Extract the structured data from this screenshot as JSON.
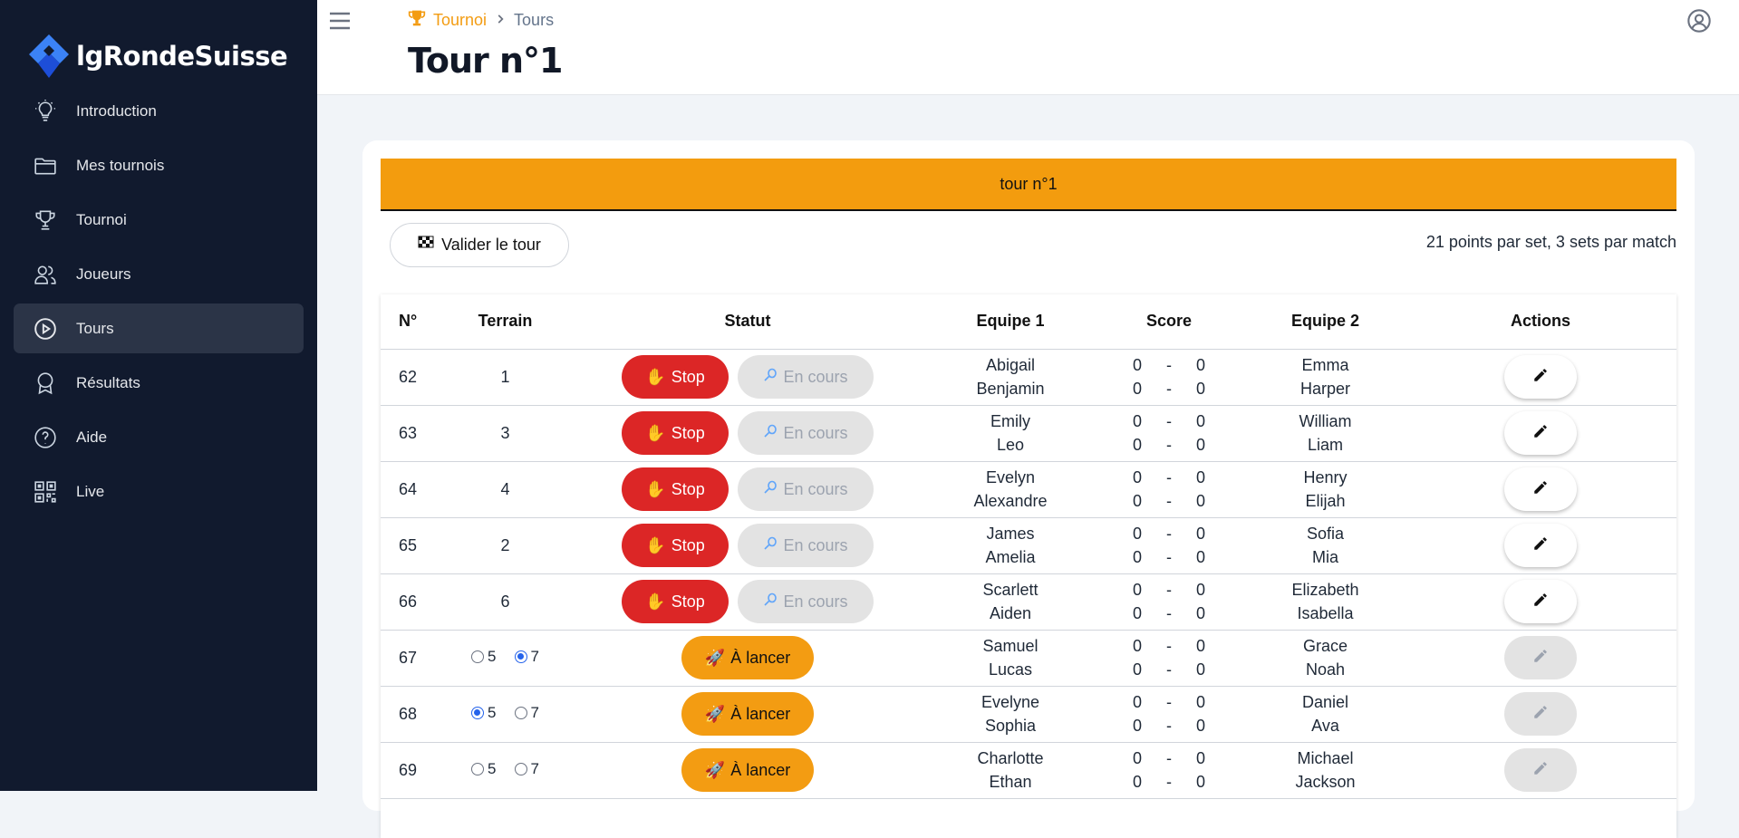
{
  "brand": {
    "name": "lgRondeSuisse"
  },
  "sidebar": {
    "items": [
      {
        "label": "Introduction",
        "icon": "lightbulb-icon"
      },
      {
        "label": "Mes tournois",
        "icon": "folder-icon"
      },
      {
        "label": "Tournoi",
        "icon": "trophy-icon"
      },
      {
        "label": "Joueurs",
        "icon": "users-icon"
      },
      {
        "label": "Tours",
        "icon": "play-circle-icon",
        "active": true
      },
      {
        "label": "Résultats",
        "icon": "ribbon-icon"
      },
      {
        "label": "Aide",
        "icon": "help-circle-icon"
      },
      {
        "label": "Live",
        "icon": "qr-code-icon"
      }
    ]
  },
  "header": {
    "breadcrumb": [
      "Tournoi",
      "Tours"
    ],
    "title": "Tour n°1"
  },
  "banner": {
    "label": "tour n°1"
  },
  "toolbar": {
    "validate_label": "Valider le tour",
    "info": "21 points par set, 3 sets par match"
  },
  "table": {
    "columns": [
      "N°",
      "Terrain",
      "Statut",
      "Equipe 1",
      "Score",
      "Equipe 2",
      "Actions"
    ],
    "stop_label": "Stop",
    "encours_label": "En cours",
    "lancer_label": "À lancer",
    "score_sep": "-",
    "rows": [
      {
        "num": "62",
        "terrain": "1",
        "team1": [
          "Abigail",
          "Benjamin"
        ],
        "team2": [
          "Emma",
          "Harper"
        ],
        "scores": [
          [
            "0",
            "0"
          ],
          [
            "0",
            "0"
          ]
        ]
      },
      {
        "num": "63",
        "terrain": "3",
        "team1": [
          "Emily",
          "Leo"
        ],
        "team2": [
          "William",
          "Liam"
        ],
        "scores": [
          [
            "0",
            "0"
          ],
          [
            "0",
            "0"
          ]
        ]
      },
      {
        "num": "64",
        "terrain": "4",
        "team1": [
          "Evelyn",
          "Alexandre"
        ],
        "team2": [
          "Henry",
          "Elijah"
        ],
        "scores": [
          [
            "0",
            "0"
          ],
          [
            "0",
            "0"
          ]
        ]
      },
      {
        "num": "65",
        "terrain": "2",
        "team1": [
          "James",
          "Amelia"
        ],
        "team2": [
          "Sofia",
          "Mia"
        ],
        "scores": [
          [
            "0",
            "0"
          ],
          [
            "0",
            "0"
          ]
        ]
      },
      {
        "num": "66",
        "terrain": "6",
        "team1": [
          "Scarlett",
          "Aiden"
        ],
        "team2": [
          "Elizabeth",
          "Isabella"
        ],
        "scores": [
          [
            "0",
            "0"
          ],
          [
            "0",
            "0"
          ]
        ]
      },
      {
        "num": "67",
        "terrain_options": [
          "5",
          "7"
        ],
        "selected": "7",
        "team1": [
          "Samuel",
          "Lucas"
        ],
        "team2": [
          "Grace",
          "Noah"
        ],
        "scores": [
          [
            "0",
            "0"
          ],
          [
            "0",
            "0"
          ]
        ]
      },
      {
        "num": "68",
        "terrain_options": [
          "5",
          "7"
        ],
        "selected": "5",
        "team1": [
          "Evelyne",
          "Sophia"
        ],
        "team2": [
          "Daniel",
          "Ava"
        ],
        "scores": [
          [
            "0",
            "0"
          ],
          [
            "0",
            "0"
          ]
        ]
      },
      {
        "num": "69",
        "terrain_options": [
          "5",
          "7"
        ],
        "selected": "",
        "team1": [
          "Charlotte",
          "Ethan"
        ],
        "team2": [
          "Michael",
          "Jackson"
        ],
        "scores": [
          [
            "0",
            "0"
          ],
          [
            "0",
            "0"
          ]
        ]
      }
    ]
  },
  "colors": {
    "accent": "#f39c12",
    "sidebar_bg": "#111a2e",
    "stop": "#dc2626"
  }
}
